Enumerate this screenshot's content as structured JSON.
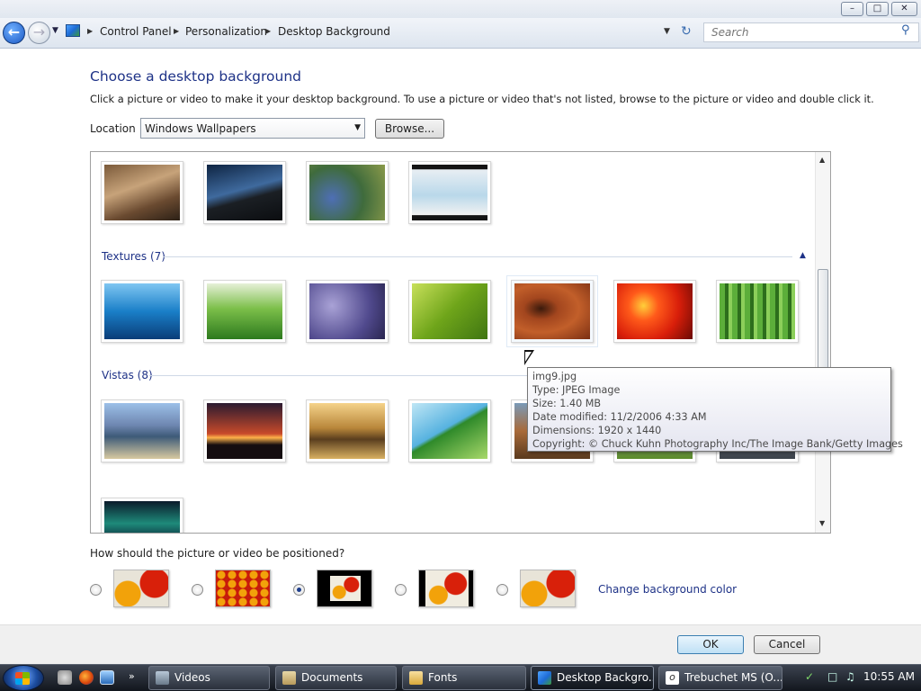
{
  "window": {
    "caption_buttons": [
      "–",
      "□",
      "✕"
    ]
  },
  "address_bar": {
    "breadcrumbs": [
      "Control Panel",
      "Personalization",
      "Desktop Background"
    ],
    "search_placeholder": "Search"
  },
  "main": {
    "title": "Choose a desktop background",
    "description": "Click a picture or video to make it your desktop background. To use a picture or video that's not listed, browse to the picture or video and double click it.",
    "location_label": "Location",
    "location_value": "Windows Wallpapers",
    "browse_label": "Browse..."
  },
  "gallery": {
    "groups": [
      {
        "label": "Textures (7)"
      },
      {
        "label": "Vistas (8)"
      }
    ]
  },
  "tooltip": {
    "lines": [
      "img9.jpg",
      "Type: JPEG Image",
      "Size: 1.40 MB",
      "Date modified: 11/2/2006 4:33 AM",
      "Dimensions: 1920 x 1440",
      "Copyright: © Chuck Kuhn Photography Inc/The Image Bank/Getty Images"
    ]
  },
  "positioning": {
    "question": "How should the picture or video be positioned?",
    "selected_index": 2,
    "change_color_label": "Change background color"
  },
  "buttons": {
    "ok": "OK",
    "cancel": "Cancel"
  },
  "taskbar": {
    "tasks": [
      "Videos",
      "Documents",
      "Fonts",
      "Desktop Backgro...",
      "Trebuchet MS (O..."
    ],
    "active_index": 3,
    "clock": "10:55 AM"
  }
}
